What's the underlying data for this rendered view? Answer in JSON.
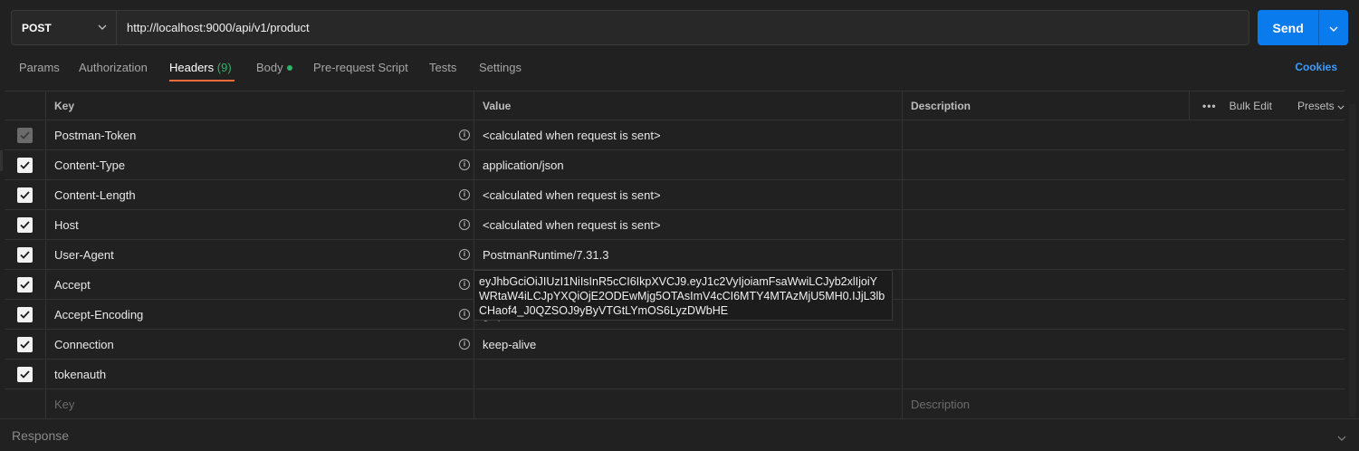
{
  "request": {
    "method": "POST",
    "url": "http://localhost:9000/api/v1/product",
    "send_label": "Send"
  },
  "tabs": [
    {
      "label": "Params"
    },
    {
      "label": "Authorization"
    },
    {
      "label": "Headers",
      "count": "(9)"
    },
    {
      "label": "Body"
    },
    {
      "label": "Pre-request Script"
    },
    {
      "label": "Tests"
    },
    {
      "label": "Settings"
    }
  ],
  "cookies_label": "Cookies",
  "table": {
    "columns": {
      "key": "Key",
      "value": "Value",
      "description": "Description"
    },
    "bulk_edit": "Bulk Edit",
    "presets": "Presets",
    "rows": [
      {
        "key": "Postman-Token",
        "value": "<calculated when request is sent>"
      },
      {
        "key": "Content-Type",
        "value": "application/json"
      },
      {
        "key": "Content-Length",
        "value": "<calculated when request is sent>"
      },
      {
        "key": "Host",
        "value": "<calculated when request is sent>"
      },
      {
        "key": "User-Agent",
        "value": "PostmanRuntime/7.31.3"
      },
      {
        "key": "Accept",
        "value": "*/*"
      },
      {
        "key": "Accept-Encoding",
        "value": "gzip, deflate, br"
      },
      {
        "key": "Connection",
        "value": "keep-alive"
      },
      {
        "key": "tokenauth",
        "value": "eyJhbGciOiJIUzI1NiIsInR5cCI6IkpXVCJ9.eyJ1c2VyIjoiamFsaWwiLCJyb2xlIjoiYWRtaW4iLCJpYXQiOjE2ODEwMjg5OTAsImV4cCI6MTY4MTAzMjU5MH0.IJjL3lbCHaof4_J0QZSOJ9yByVTGtLYmOS6LyzDWbHE"
      }
    ],
    "new_row": {
      "key_placeholder": "Key",
      "description_placeholder": "Description"
    }
  },
  "response_label": "Response",
  "colors": {
    "accent": "#097bed",
    "active_tab_underline": "#f26b3a",
    "count": "#2fb36b"
  }
}
